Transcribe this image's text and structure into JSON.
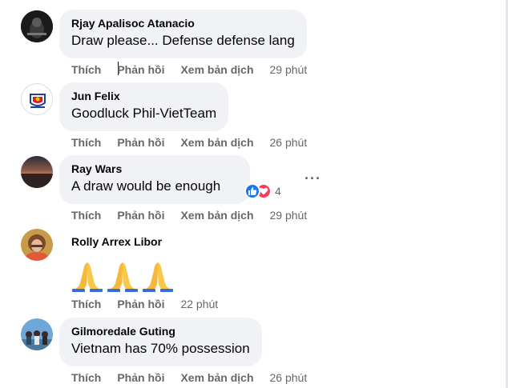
{
  "comments": [
    {
      "author": "Rjay Apalisoc Atanacio",
      "text": "Draw please... Defense defense lang",
      "like": "Thích",
      "reply": "Phản hồi",
      "translate": "Xem bản dịch",
      "time": "29 phút"
    },
    {
      "author": "Jun Felix",
      "text": "Goodluck Phil-VietTeam",
      "like": "Thích",
      "reply": "Phản hồi",
      "translate": "Xem bản dịch",
      "time": "26 phút"
    },
    {
      "author": "Ray Wars",
      "text": "A draw would be enough",
      "like": "Thích",
      "reply": "Phản hồi",
      "translate": "Xem bản dịch",
      "time": "29 phút",
      "reaction_count": "4",
      "reactions": [
        "like-icon",
        "love-icon"
      ]
    },
    {
      "author": "Rolly Arrex Libor",
      "emoji": [
        "folded-hands-icon",
        "folded-hands-icon",
        "folded-hands-icon"
      ],
      "like": "Thích",
      "reply": "Phản hồi",
      "time": "22 phút"
    },
    {
      "author": "Gilmoredale Guting",
      "text": "Vietnam has 70% possession",
      "like": "Thích",
      "reply": "Phản hồi",
      "translate": "Xem bản dịch",
      "time": "26 phút"
    }
  ],
  "colors": {
    "bubble": "#f0f2f5",
    "meta_text": "#65676b",
    "like_blue": "#1877f2",
    "love_red": "#f33e58"
  }
}
